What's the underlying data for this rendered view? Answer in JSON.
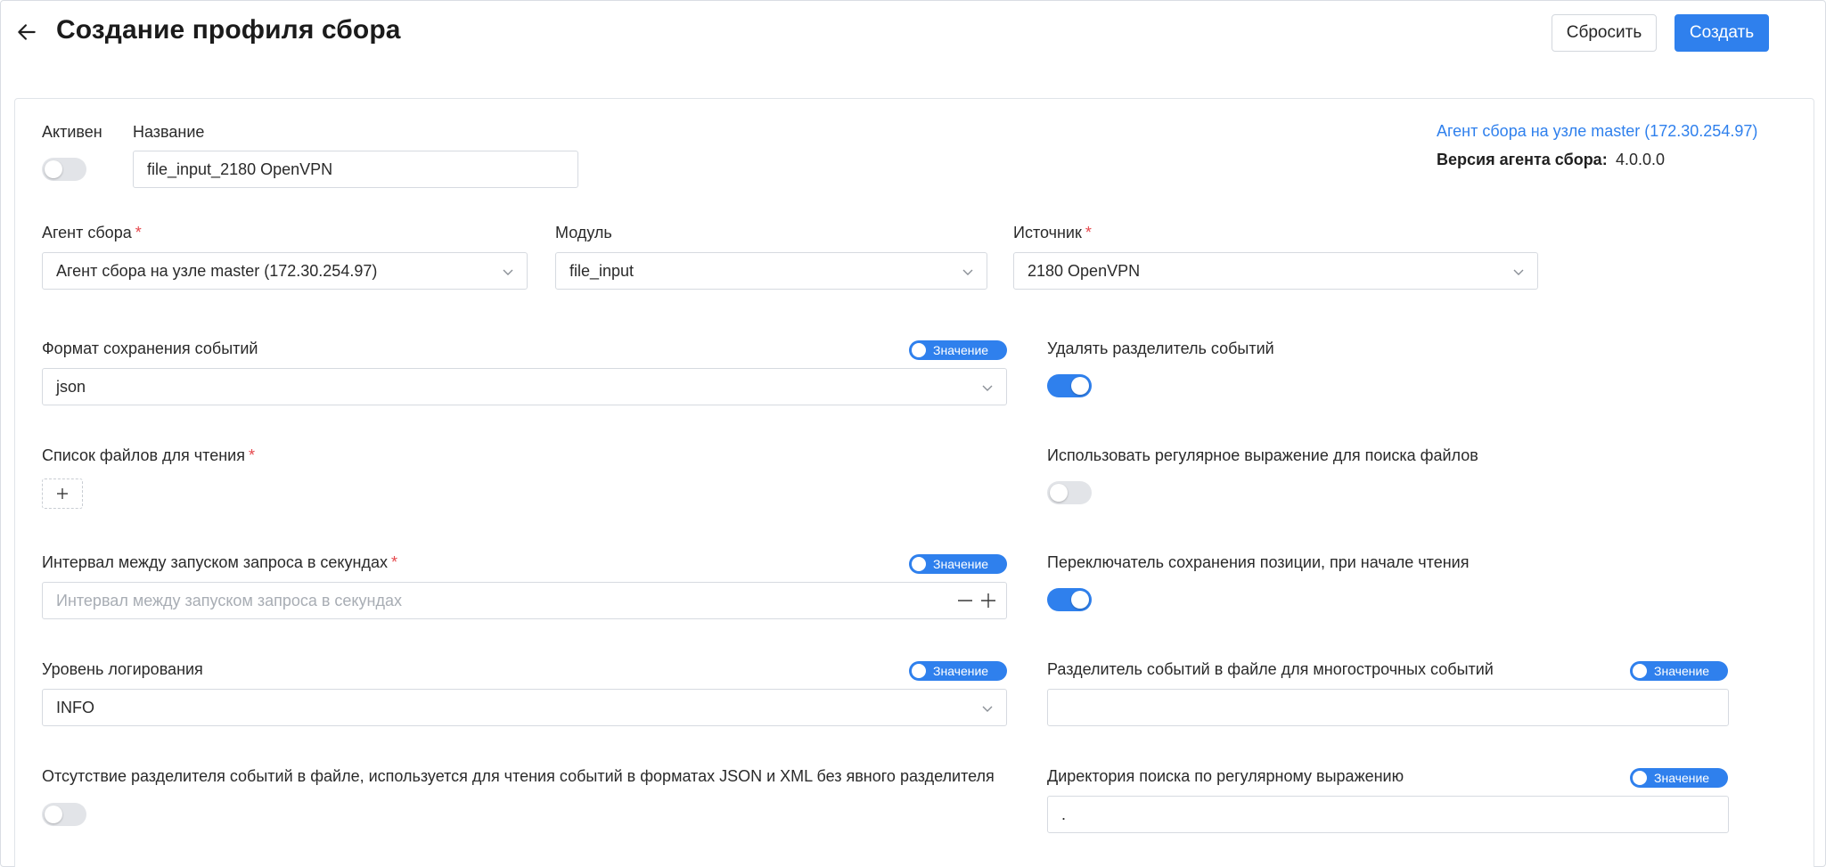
{
  "header": {
    "title": "Создание профиля сбора",
    "reset_label": "Сбросить",
    "create_label": "Создать"
  },
  "info": {
    "agent_link": "Агент сбора на узле master (172.30.254.97)",
    "version_label": "Версия агента сбора:",
    "version_value": "4.0.0.0"
  },
  "form": {
    "active_label": "Активен",
    "active_on": false,
    "name_label": "Название",
    "name_value": "file_input_2180 OpenVPN",
    "agent_label": "Агент сбора",
    "agent_value": "Агент сбора на узле master (172.30.254.97)",
    "module_label": "Модуль",
    "module_value": "file_input",
    "source_label": "Источник",
    "source_value": "2180 OpenVPN",
    "required_mark": "*",
    "value_pill_label": "Значение",
    "format_label": "Формат сохранения событий",
    "format_value": "json",
    "remove_delim_label": "Удалять разделитель событий",
    "remove_delim_on": true,
    "files_label": "Список файлов для чтения",
    "regex_label": "Использовать регулярное выражение для поиска файлов",
    "regex_on": false,
    "interval_label": "Интервал между запуском запроса в секундах",
    "interval_placeholder": "Интервал между запуском запроса в секундах",
    "position_label": "Переключатель сохранения позиции, при начале чтения",
    "position_on": true,
    "log_level_label": "Уровень логирования",
    "log_level_value": "INFO",
    "multiline_delim_label": "Разделитель событий в файле для многострочных событий",
    "multiline_delim_value": "",
    "no_delim_label": "Отсутствие разделителя событий в файле, используется для чтения событий в форматах JSON и XML без явного разделителя",
    "no_delim_on": false,
    "regex_dir_label": "Директория поиска по регулярному выражению",
    "regex_dir_value": "."
  },
  "colors": {
    "accent": "#2f80ed",
    "required": "#e5484d",
    "toggle_off": "#e2e4e8"
  }
}
